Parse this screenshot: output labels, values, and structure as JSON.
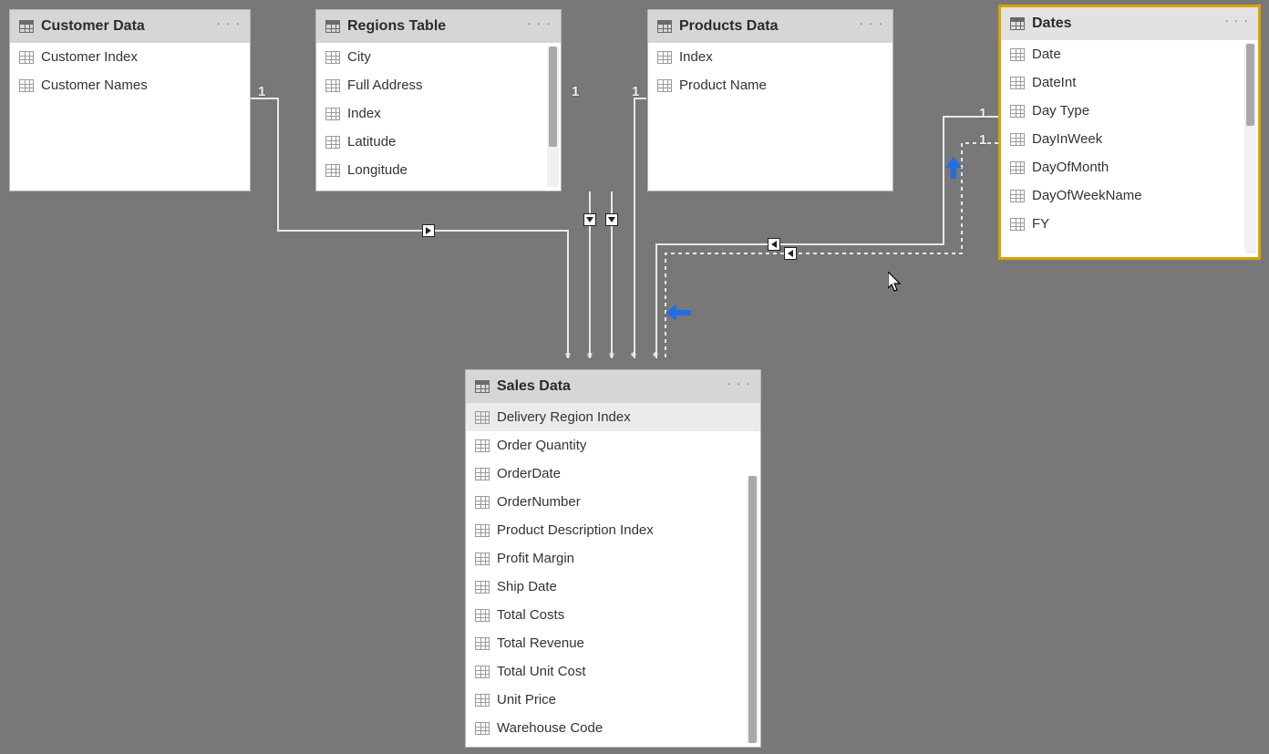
{
  "tables": {
    "customer": {
      "title": "Customer Data",
      "fields": [
        "Customer Index",
        "Customer Names"
      ]
    },
    "regions": {
      "title": "Regions Table",
      "fields": [
        "City",
        "Full Address",
        "Index",
        "Latitude",
        "Longitude"
      ]
    },
    "products": {
      "title": "Products Data",
      "fields": [
        "Index",
        "Product Name"
      ]
    },
    "dates": {
      "title": "Dates",
      "fields": [
        "Date",
        "DateInt",
        "Day Type",
        "DayInWeek",
        "DayOfMonth",
        "DayOfWeekName",
        "FY"
      ]
    },
    "sales": {
      "title": "Sales Data",
      "fields": [
        "Delivery Region Index",
        "Order Quantity",
        "OrderDate",
        "OrderNumber",
        "Product Description Index",
        "Profit Margin",
        "Ship Date",
        "Total Costs",
        "Total Revenue",
        "Total Unit Cost",
        "Unit Price",
        "Warehouse Code"
      ]
    }
  },
  "cardinality": {
    "one": "1",
    "many": "*"
  },
  "menu": {
    "ellipsis": "· · ·"
  }
}
